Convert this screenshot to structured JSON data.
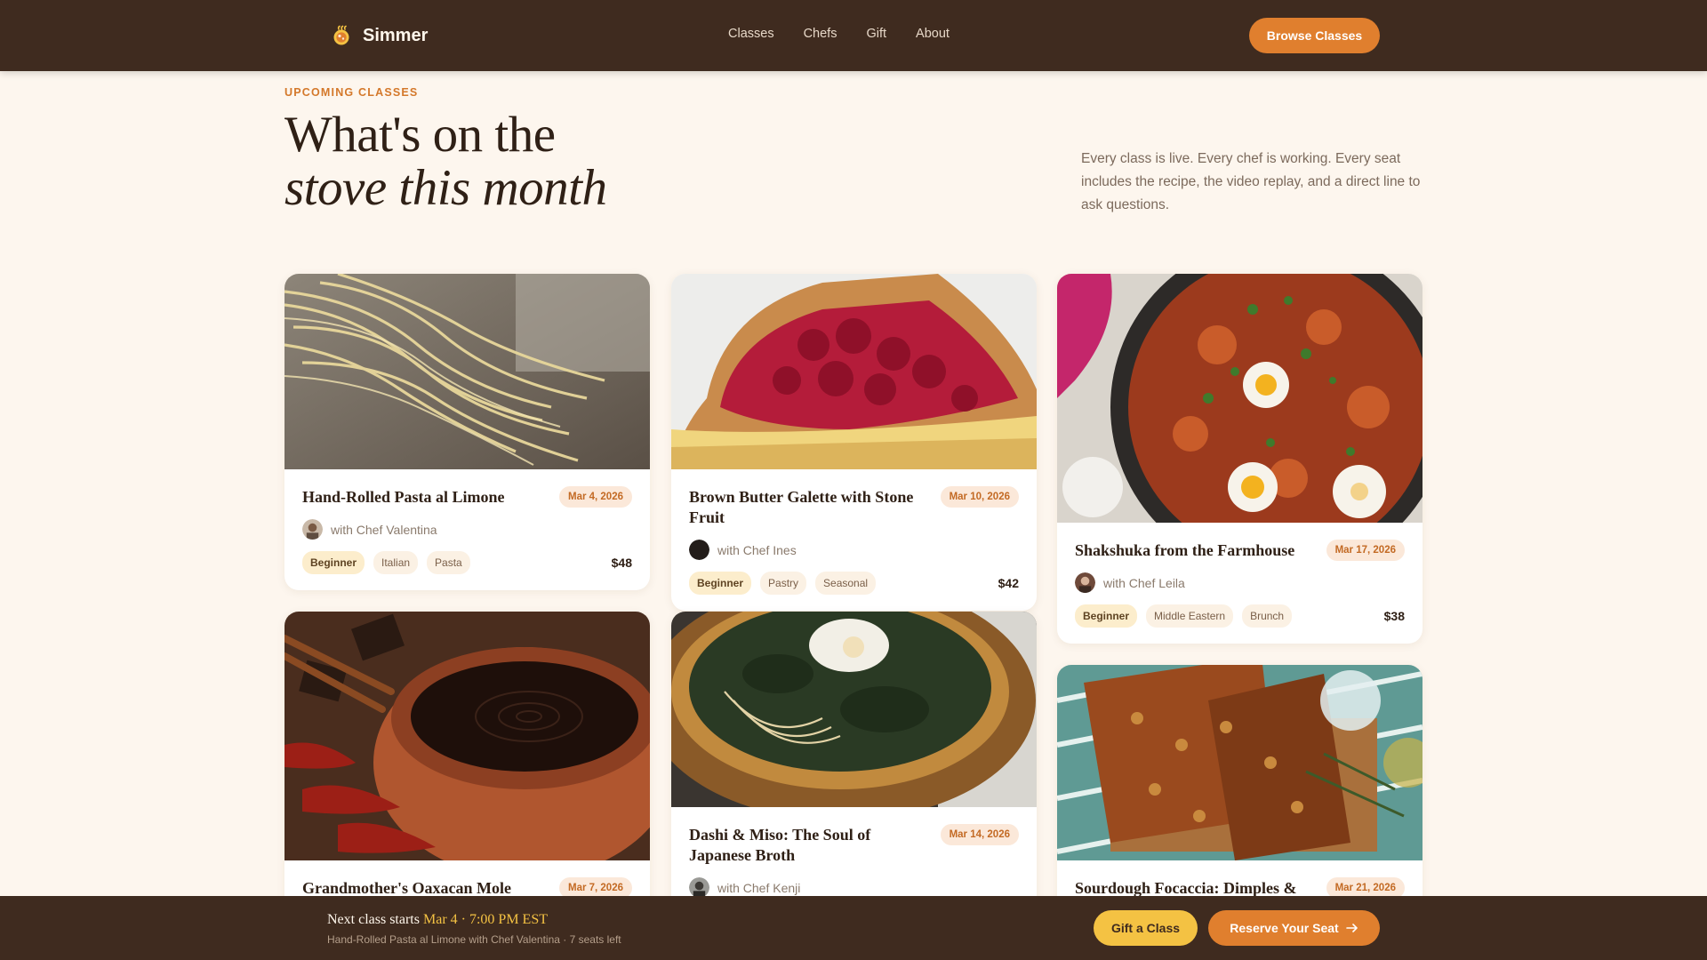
{
  "header": {
    "brand_name": "Simmer",
    "logo_icon": "pot-logo-icon",
    "nav": [
      "Classes",
      "Chefs",
      "Gift",
      "About"
    ],
    "cta_label": "Browse Classes"
  },
  "hero": {
    "eyebrow": "UPCOMING CLASSES",
    "title_line1": "What's on the",
    "title_line2": "stove this month",
    "description": "Every class is live. Every chef is working. Every seat includes the recipe, the video replay, and a direct line to ask questions."
  },
  "cards": [
    {
      "title": "Hand-Rolled Pasta al Limone",
      "date": "Mar 4, 2026",
      "chef": "with Chef Valentina",
      "tags": [
        "Beginner",
        "Italian",
        "Pasta"
      ],
      "price": "$48",
      "image": "fresh-pasta-photo"
    },
    {
      "title": "Brown Butter Galette with Stone Fruit",
      "date": "Mar 10, 2026",
      "chef": "with Chef Ines",
      "tags": [
        "Beginner",
        "Pastry",
        "Seasonal"
      ],
      "price": "$42",
      "image": "cherry-galette-photo"
    },
    {
      "title": "Shakshuka from the Farmhouse",
      "date": "Mar 17, 2026",
      "chef": "with Chef Leila",
      "tags": [
        "Beginner",
        "Middle Eastern",
        "Brunch"
      ],
      "price": "$38",
      "image": "shakshuka-photo"
    },
    {
      "title": "Grandmother's Oaxacan Mole Negro",
      "date": "Mar 7, 2026",
      "chef": "",
      "tags": [],
      "price": "",
      "image": "mole-negro-photo"
    },
    {
      "title": "Dashi & Miso: The Soul of Japanese Broth",
      "date": "Mar 14, 2026",
      "chef": "with Chef Kenji",
      "tags": [],
      "price": "",
      "image": "miso-soup-photo"
    },
    {
      "title": "Sourdough Focaccia: Dimples &",
      "date": "Mar 21, 2026",
      "chef": "",
      "tags": [],
      "price": "",
      "image": "focaccia-photo"
    }
  ],
  "bottom_bar": {
    "lead": "Next class starts",
    "highlight": "Mar 4 · 7:00 PM EST",
    "sub": "Hand-Rolled Pasta al Limone with Chef Valentina · 7 seats left",
    "gift_label": "Gift a Class",
    "reserve_label": "Reserve Your Seat"
  },
  "colors": {
    "accent": "#e07f2e",
    "dark": "#3f2b1f",
    "background": "#fdf6ee",
    "highlight": "#f4c243"
  }
}
